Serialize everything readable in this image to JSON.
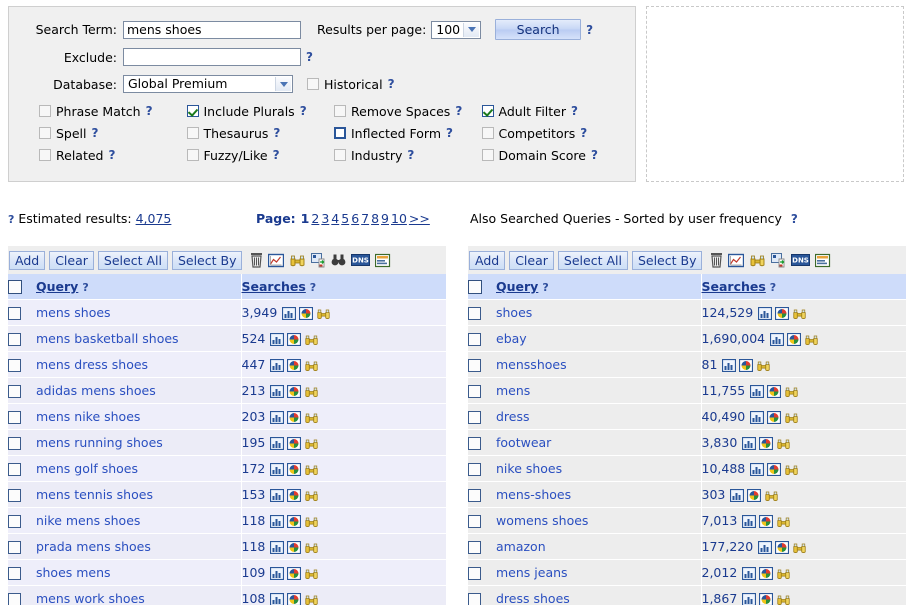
{
  "form": {
    "search_term_label": "Search Term:",
    "search_term_value": "mens shoes",
    "exclude_label": "Exclude:",
    "exclude_value": "",
    "database_label": "Database:",
    "database_value": "Global Premium",
    "results_per_page_label": "Results per page:",
    "results_per_page_value": "100",
    "search_button": "Search",
    "historical_label": "Historical",
    "help_glyph": "?",
    "checkboxes": [
      {
        "label": "Phrase Match",
        "checked": false,
        "focused": false
      },
      {
        "label": "Include Plurals",
        "checked": true,
        "focused": false
      },
      {
        "label": "Remove Spaces",
        "checked": false,
        "focused": false
      },
      {
        "label": "Adult Filter",
        "checked": true,
        "focused": false
      },
      {
        "label": "Spell",
        "checked": false,
        "focused": false
      },
      {
        "label": "Thesaurus",
        "checked": false,
        "focused": false
      },
      {
        "label": "Inflected Form",
        "checked": false,
        "focused": true
      },
      {
        "label": "Competitors",
        "checked": false,
        "focused": false
      },
      {
        "label": "Related",
        "checked": false,
        "focused": false
      },
      {
        "label": "Fuzzy/Like",
        "checked": false,
        "focused": false
      },
      {
        "label": "Industry",
        "checked": false,
        "focused": false
      },
      {
        "label": "Domain Score",
        "checked": false,
        "focused": false
      }
    ]
  },
  "status": {
    "estimated_label": "Estimated results:",
    "estimated_value": "4,075",
    "page_label": "Page:",
    "pages": [
      "1",
      "2",
      "3",
      "4",
      "5",
      "6",
      "7",
      "8",
      "9",
      "10"
    ],
    "current_page": "1",
    "next_label": ">>",
    "also_searched_title": "Also Searched Queries - Sorted by user frequency"
  },
  "toolbar": {
    "add": "Add",
    "clear": "Clear",
    "select_all": "Select All",
    "select_by": "Select By",
    "icons": [
      "trash-icon",
      "line-chart-icon",
      "binoculars-gold-icon",
      "image-export-icon",
      "binoculars-icon",
      "dns-icon",
      "list-report-icon"
    ]
  },
  "columns": {
    "query": "Query",
    "searches": "Searches"
  },
  "left_table": {
    "rows": [
      {
        "query": "mens shoes",
        "searches": "3,949"
      },
      {
        "query": "mens basketball shoes",
        "searches": "524"
      },
      {
        "query": "mens dress shoes",
        "searches": "447"
      },
      {
        "query": "adidas mens shoes",
        "searches": "213"
      },
      {
        "query": "mens nike shoes",
        "searches": "203"
      },
      {
        "query": "mens running shoes",
        "searches": "195"
      },
      {
        "query": "mens golf shoes",
        "searches": "172"
      },
      {
        "query": "mens tennis shoes",
        "searches": "153"
      },
      {
        "query": "nike mens shoes",
        "searches": "118"
      },
      {
        "query": "prada mens shoes",
        "searches": "118"
      },
      {
        "query": "shoes mens",
        "searches": "109"
      },
      {
        "query": "mens work shoes",
        "searches": "108"
      }
    ]
  },
  "right_table": {
    "rows": [
      {
        "query": "shoes",
        "searches": "124,529"
      },
      {
        "query": "ebay",
        "searches": "1,690,004"
      },
      {
        "query": "mensshoes",
        "searches": "81"
      },
      {
        "query": "mens",
        "searches": "11,755"
      },
      {
        "query": "dress",
        "searches": "40,490"
      },
      {
        "query": "footwear",
        "searches": "3,830"
      },
      {
        "query": "nike shoes",
        "searches": "10,488"
      },
      {
        "query": "mens-shoes",
        "searches": "303"
      },
      {
        "query": "womens shoes",
        "searches": "7,013"
      },
      {
        "query": "amazon",
        "searches": "177,220"
      },
      {
        "query": "mens jeans",
        "searches": "2,012"
      },
      {
        "query": "dress shoes",
        "searches": "1,867"
      }
    ]
  },
  "colors": {
    "header_row": "#cedcfa",
    "link": "#2a4fc0",
    "accent": "#1a3a8f",
    "panel_bg": "#f0f0f0"
  }
}
